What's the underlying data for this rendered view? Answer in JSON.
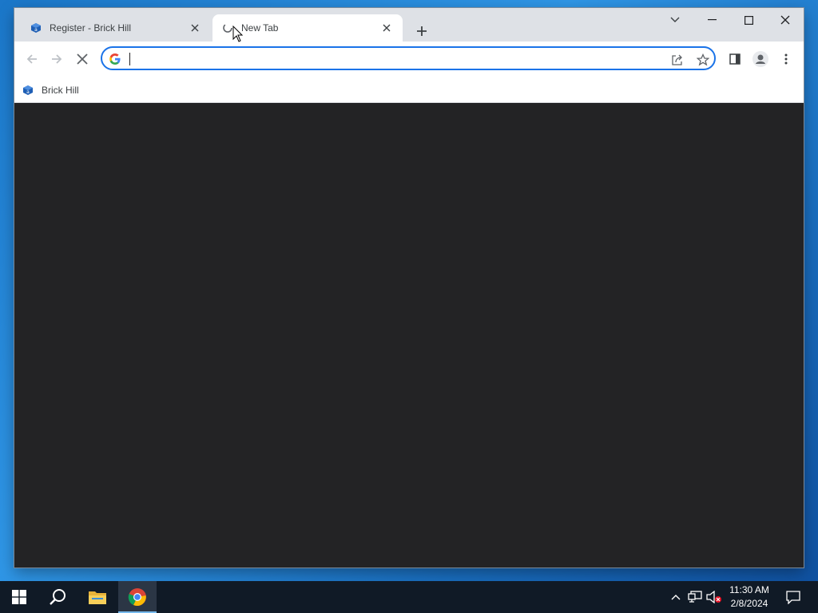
{
  "browser": {
    "tabs": [
      {
        "label": "Register - Brick Hill",
        "active": false,
        "icon": "brick-hill-icon"
      },
      {
        "label": "New Tab",
        "active": true,
        "icon": "loading-icon"
      }
    ],
    "new_tab_icon": "plus-icon",
    "window_controls": [
      "tab-search-icon",
      "minimize-icon",
      "maximize-icon",
      "close-icon"
    ],
    "toolbar": {
      "back_icon": "back-arrow-icon",
      "forward_icon": "forward-arrow-icon",
      "stop_icon": "stop-icon",
      "omnibox_value": "",
      "omnibox_icon": "google-icon",
      "share_icon": "share-icon",
      "bookmark_icon": "star-icon",
      "side_panel_icon": "side-panel-icon",
      "profile_icon": "profile-icon",
      "menu_icon": "kebab-menu-icon"
    },
    "bookmarks": [
      {
        "label": "Brick Hill",
        "icon": "brick-hill-icon"
      }
    ],
    "accent": "#1a73e8",
    "content_bg": "#232325"
  },
  "taskbar": {
    "items": [
      "windows-start-icon",
      "search-icon",
      "file-explorer-icon",
      "chrome-icon"
    ],
    "active_item": "chrome-icon",
    "tray": [
      "chevron-up-icon",
      "network-icon",
      "volume-muted-icon"
    ],
    "time": "11:30 AM",
    "date": "2/8/2024",
    "notification_icon": "notification-icon"
  }
}
